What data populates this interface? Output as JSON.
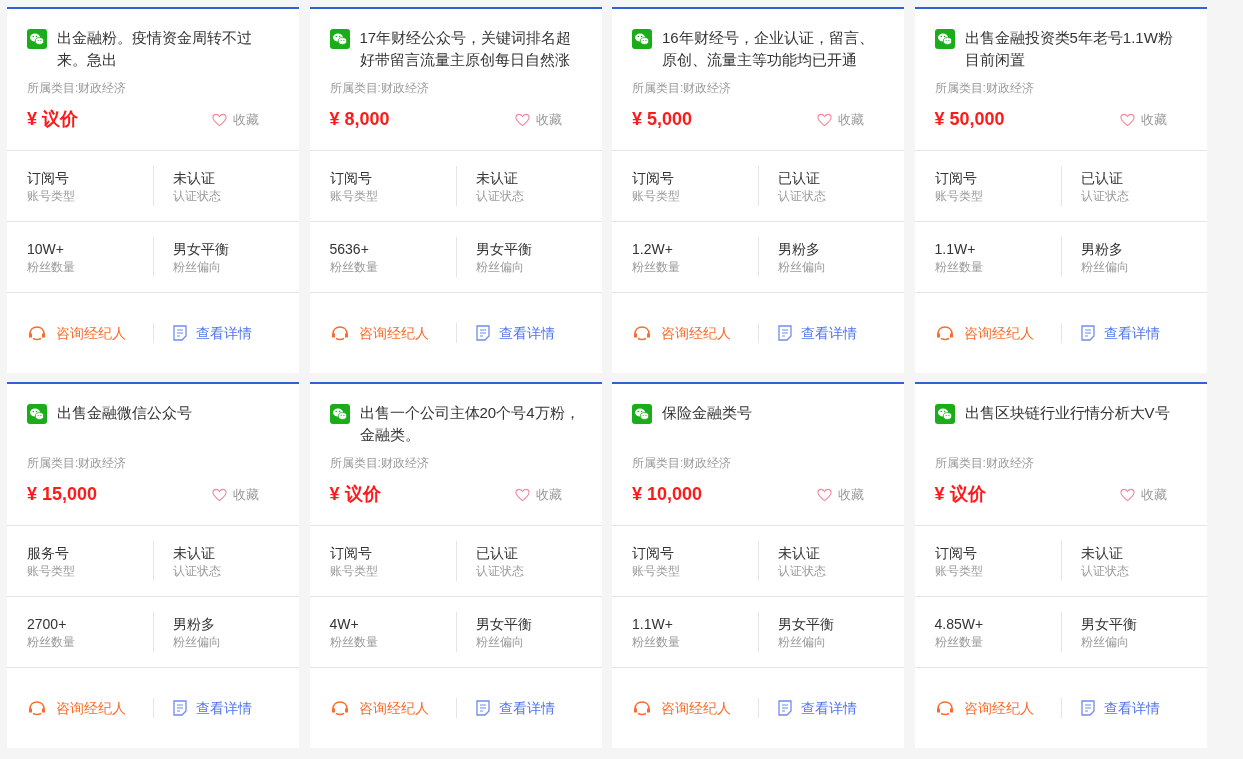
{
  "cards": [
    {
      "title": "出金融粉。疫情资金周转不过来。急出",
      "category": "所属类目:财政经济",
      "price": "¥ 议价",
      "favorite": {
        "label": "收藏",
        "favorited": false
      },
      "stats": [
        {
          "value": "订阅号",
          "label": "账号类型"
        },
        {
          "value": "未认证",
          "label": "认证状态"
        },
        {
          "value": "10W+",
          "label": "粉丝数量"
        },
        {
          "value": "男女平衡",
          "label": "粉丝偏向"
        }
      ],
      "actions": [
        {
          "kind": "consult",
          "label": "咨询经纪人"
        },
        {
          "kind": "details",
          "label": "查看详情"
        }
      ]
    },
    {
      "title": "17年财经公众号，关键词排名超好带留言流量主原创每日自然涨",
      "category": "所属类目:财政经济",
      "price": "¥ 8,000",
      "favorite": {
        "label": "收藏",
        "favorited": false
      },
      "stats": [
        {
          "value": "订阅号",
          "label": "账号类型"
        },
        {
          "value": "未认证",
          "label": "认证状态"
        },
        {
          "value": "5636+",
          "label": "粉丝数量"
        },
        {
          "value": "男女平衡",
          "label": "粉丝偏向"
        }
      ],
      "actions": [
        {
          "kind": "consult",
          "label": "咨询经纪人"
        },
        {
          "kind": "details",
          "label": "查看详情"
        }
      ]
    },
    {
      "title": "16年财经号，企业认证，留言、原创、流量主等功能均已开通",
      "category": "所属类目:财政经济",
      "price": "¥ 5,000",
      "favorite": {
        "label": "收藏",
        "favorited": false
      },
      "stats": [
        {
          "value": "订阅号",
          "label": "账号类型"
        },
        {
          "value": "已认证",
          "label": "认证状态"
        },
        {
          "value": "1.2W+",
          "label": "粉丝数量"
        },
        {
          "value": "男粉多",
          "label": "粉丝偏向"
        }
      ],
      "actions": [
        {
          "kind": "consult",
          "label": "咨询经纪人"
        },
        {
          "kind": "details",
          "label": "查看详情"
        }
      ]
    },
    {
      "title": "出售金融投资类5年老号1.1W粉目前闲置",
      "category": "所属类目:财政经济",
      "price": "¥ 50,000",
      "favorite": {
        "label": "收藏",
        "favorited": false
      },
      "stats": [
        {
          "value": "订阅号",
          "label": "账号类型"
        },
        {
          "value": "已认证",
          "label": "认证状态"
        },
        {
          "value": "1.1W+",
          "label": "粉丝数量"
        },
        {
          "value": "男粉多",
          "label": "粉丝偏向"
        }
      ],
      "actions": [
        {
          "kind": "consult",
          "label": "咨询经纪人"
        },
        {
          "kind": "details",
          "label": "查看详情"
        }
      ]
    },
    {
      "title": "出售金融微信公众号",
      "category": "所属类目:财政经济",
      "price": "¥ 15,000",
      "favorite": {
        "label": "收藏",
        "favorited": false
      },
      "stats": [
        {
          "value": "服务号",
          "label": "账号类型"
        },
        {
          "value": "未认证",
          "label": "认证状态"
        },
        {
          "value": "2700+",
          "label": "粉丝数量"
        },
        {
          "value": "男粉多",
          "label": "粉丝偏向"
        }
      ],
      "actions": [
        {
          "kind": "consult",
          "label": "咨询经纪人"
        },
        {
          "kind": "details",
          "label": "查看详情"
        }
      ]
    },
    {
      "title": "出售一个公司主体20个号4万粉，金融类。",
      "category": "所属类目:财政经济",
      "price": "¥ 议价",
      "favorite": {
        "label": "收藏",
        "favorited": false
      },
      "stats": [
        {
          "value": "订阅号",
          "label": "账号类型"
        },
        {
          "value": "已认证",
          "label": "认证状态"
        },
        {
          "value": "4W+",
          "label": "粉丝数量"
        },
        {
          "value": "男女平衡",
          "label": "粉丝偏向"
        }
      ],
      "actions": [
        {
          "kind": "consult",
          "label": "咨询经纪人"
        },
        {
          "kind": "details",
          "label": "查看详情"
        }
      ]
    },
    {
      "title": "保险金融类号",
      "category": "所属类目:财政经济",
      "price": "¥ 10,000",
      "favorite": {
        "label": "收藏",
        "favorited": false
      },
      "stats": [
        {
          "value": "订阅号",
          "label": "账号类型"
        },
        {
          "value": "未认证",
          "label": "认证状态"
        },
        {
          "value": "1.1W+",
          "label": "粉丝数量"
        },
        {
          "value": "男女平衡",
          "label": "粉丝偏向"
        }
      ],
      "actions": [
        {
          "kind": "consult",
          "label": "咨询经纪人"
        },
        {
          "kind": "details",
          "label": "查看详情"
        }
      ]
    },
    {
      "title": "出售区块链行业行情分析大V号",
      "category": "所属类目:财政经济",
      "price": "¥ 议价",
      "favorite": {
        "label": "收藏",
        "favorited": false
      },
      "stats": [
        {
          "value": "订阅号",
          "label": "账号类型"
        },
        {
          "value": "未认证",
          "label": "认证状态"
        },
        {
          "value": "4.85W+",
          "label": "粉丝数量"
        },
        {
          "value": "男女平衡",
          "label": "粉丝偏向"
        }
      ],
      "actions": [
        {
          "kind": "consult",
          "label": "咨询经纪人"
        },
        {
          "kind": "details",
          "label": "查看详情"
        }
      ]
    }
  ]
}
